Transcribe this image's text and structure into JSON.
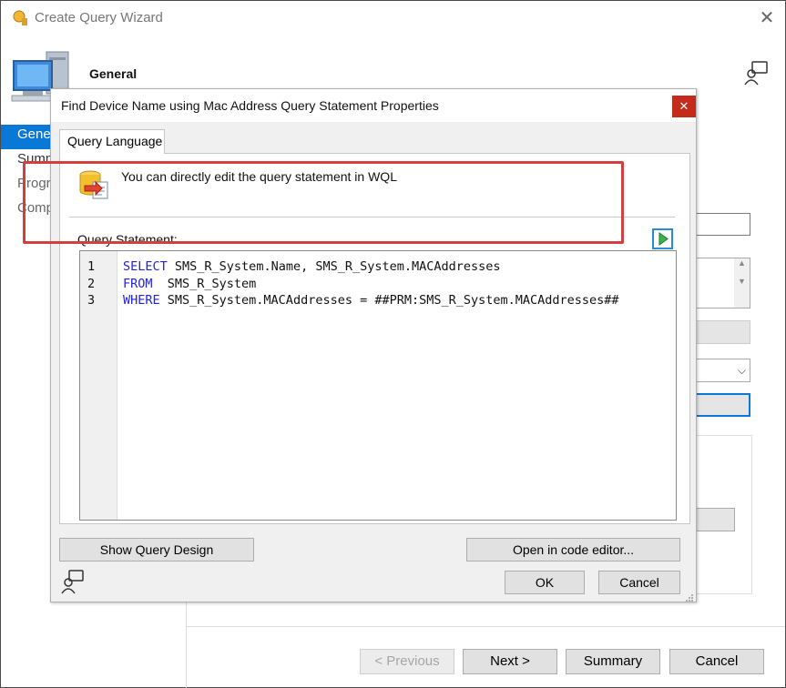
{
  "wizard": {
    "title": "Create Query Wizard",
    "close_glyph": "✕",
    "heading": "General",
    "nav": [
      "General",
      "Summary",
      "Progress",
      "Completion"
    ],
    "buttons": {
      "previous": "< Previous",
      "next": "Next >",
      "summary": "Summary",
      "cancel": "Cancel"
    },
    "icons": [
      "wizard-app-icon",
      "computer-icon",
      "help-person-icon"
    ]
  },
  "dialog": {
    "title": "Find Device Name using Mac Address Query Statement Properties",
    "close_glyph": "✕",
    "tab_label": "Query Language",
    "info_text": "You can directly edit the query statement in WQL",
    "query_label": "Query Statement:",
    "code_lines": [
      {
        "num": "1",
        "keyword": "SELECT",
        "rest": " SMS_R_System.Name, SMS_R_System.MACAddresses"
      },
      {
        "num": "2",
        "keyword": "FROM",
        "rest": "  SMS_R_System"
      },
      {
        "num": "3",
        "keyword": "WHERE",
        "rest": " SMS_R_System.MACAddresses = ##PRM:SMS_R_System.MACAddresses##"
      }
    ],
    "buttons": {
      "show_query_design": "Show Query Design",
      "open_in_code_editor": "Open in code editor...",
      "ok": "OK",
      "cancel": "Cancel"
    },
    "colors": {
      "keyword": "#2222dd",
      "highlight_border": "#d23f3f",
      "close_bg": "#c42b1c",
      "accent": "#0a78d7"
    }
  }
}
